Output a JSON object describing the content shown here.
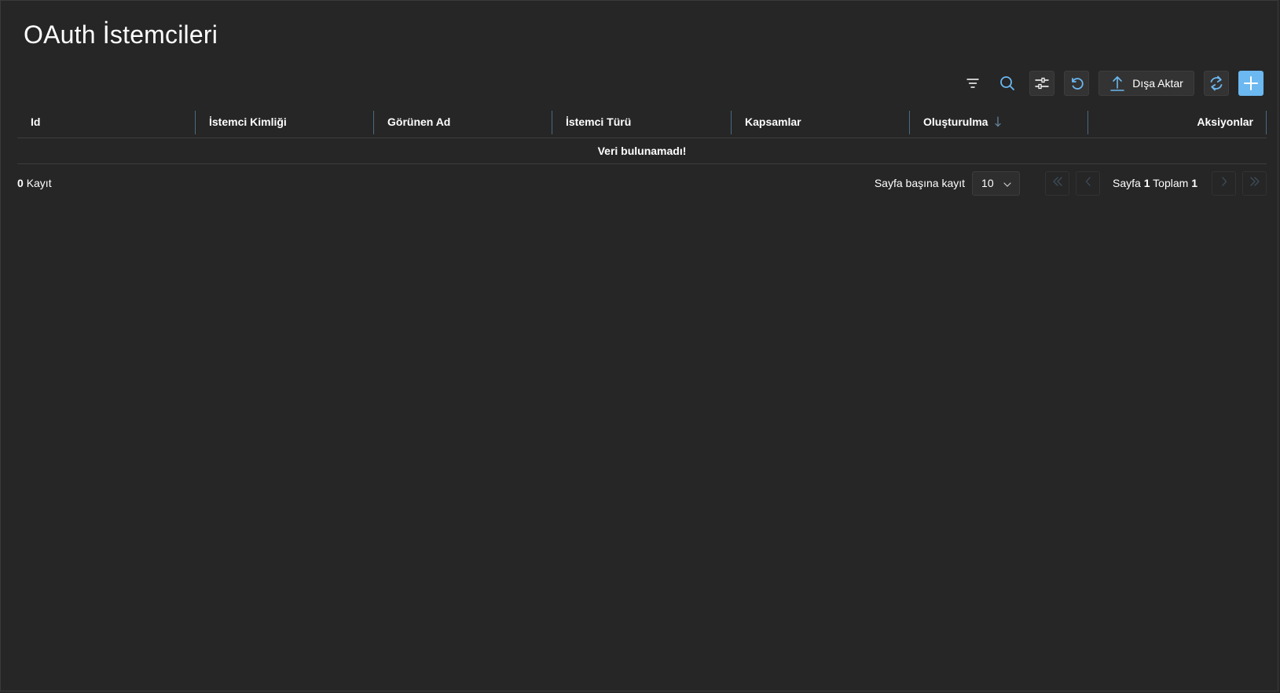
{
  "page": {
    "title": "OAuth İstemcileri"
  },
  "toolbar": {
    "filter_icon": "filter-lines-icon",
    "search_icon": "search-icon",
    "columns_icon": "sliders-icon",
    "reset_icon": "undo-icon",
    "export_label": "Dışa Aktar",
    "export_icon": "upload-icon",
    "refresh_icon": "refresh-icon",
    "add_icon": "plus-icon"
  },
  "table": {
    "columns": [
      {
        "label": "Id"
      },
      {
        "label": "İstemci Kimliği"
      },
      {
        "label": "Görünen Ad"
      },
      {
        "label": "İstemci Türü"
      },
      {
        "label": "Kapsamlar"
      },
      {
        "label": "Oluşturulma",
        "sort": "desc"
      },
      {
        "label": "Aksiyonlar"
      }
    ],
    "empty_message": "Veri bulunamadı!"
  },
  "footer": {
    "count": "0",
    "count_suffix": "Kayıt",
    "per_page_label": "Sayfa başına kayıt",
    "per_page_value": "10",
    "page_prefix": "Sayfa",
    "page_current": "1",
    "page_middle": "Toplam",
    "page_total": "1"
  },
  "colors": {
    "background": "#262626",
    "accent": "#6cb8f0",
    "border": "#3d3d3d",
    "column_separator": "#4a6a85"
  }
}
